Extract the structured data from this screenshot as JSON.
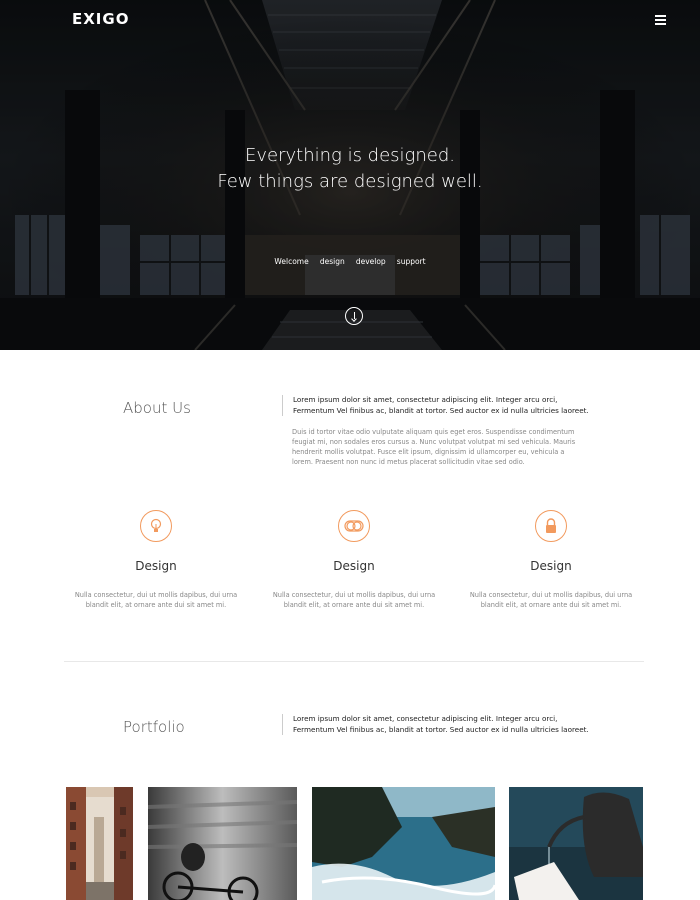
{
  "header": {
    "brand": "EXIGO",
    "menu_icon": "hamburger-menu-icon"
  },
  "hero": {
    "title_line1": "Everything is designed.",
    "title_line2": "Few things are designed well.",
    "nav": [
      "Welcome",
      "design",
      "develop",
      "support"
    ],
    "scroll_icon": "scroll-down-icon"
  },
  "about": {
    "title": "About Us",
    "lead": "Lorem ipsum dolor sit amet, consectetur adipiscing elit. Integer arcu orci, Fermentum Vel finibus ac, blandit at tortor. Sed auctor ex id nulla ultricies laoreet.",
    "body": "Duis id tortor vitae odio vulputate aliquam quis eget eros. Suspendisse condimentum feugiat mi, non sodales eros cursus a. Nunc volutpat volutpat mi sed vehicula. Mauris hendrerit mollis volutpat. Fusce elit ipsum, dignissim id ullamcorper eu, vehicula a lorem. Praesent non nunc id metus placerat sollicitudin vitae sed odio."
  },
  "features": [
    {
      "icon": "lightbulb-icon",
      "title": "Design",
      "text": "Nulla consectetur, dui ut mollis dapibus, dui urna blandit elit, at ornare ante dui sit amet mi."
    },
    {
      "icon": "toggle-icon",
      "title": "Design",
      "text": "Nulla consectetur, dui ut mollis dapibus, dui urna blandit elit, at ornare ante dui sit amet mi."
    },
    {
      "icon": "lock-icon",
      "title": "Design",
      "text": "Nulla consectetur, dui ut mollis dapibus, dui urna blandit elit, at ornare ante dui sit amet mi."
    }
  ],
  "portfolio": {
    "title": "Portfolio",
    "lead": "Lorem ipsum dolor sit amet, consectetur adipiscing elit. Integer arcu orci, Fermentum Vel finibus ac, blandit at tortor. Sed auctor ex id nulla ultricies laoreet."
  },
  "colors": {
    "accent": "#f29a5e",
    "hero_bg": "#111416"
  }
}
